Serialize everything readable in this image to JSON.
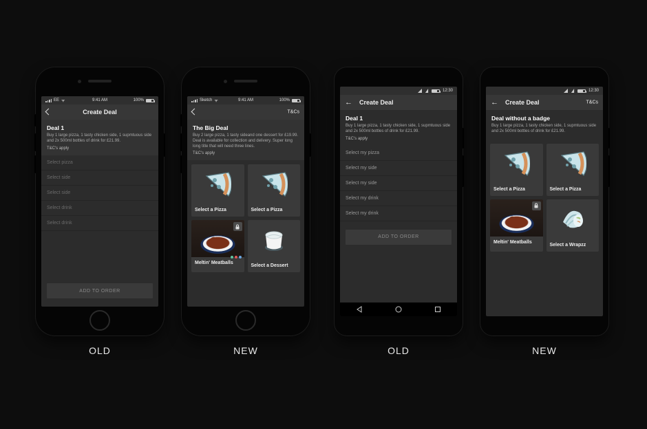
{
  "captions": {
    "p1": "OLD",
    "p2": "NEW",
    "p3": "OLD",
    "p4": "NEW"
  },
  "ios_status": {
    "carrier": "EE",
    "time": "9:41 AM",
    "battery": "100%"
  },
  "sketch_status": {
    "carrier": "Sketch",
    "time": "9:41 AM",
    "battery": "100%"
  },
  "android_status": {
    "time": "12:30"
  },
  "phone1": {
    "nav_title": "Create Deal",
    "deal_title": "Deal 1",
    "deal_desc": "Buy 1 large pizza, 1 tasty chicken side, 1 supmtuous side and 2x 500ml bottles of drink for £21.99.",
    "tcs": "T&C's apply",
    "rows": [
      "Select pizza",
      "Select side",
      "Select side",
      "Select drink",
      "Select drink"
    ],
    "cta": "ADD TO ORDER"
  },
  "phone2": {
    "nav_title": "Create Deal",
    "nav_right": "T&Cs",
    "deal_title": "The Big Deal",
    "deal_desc": "Buy 2 large pizza, 1 tasty sideand one dessert for £19.99. Deal is available for collection and delivery. Super long long title that will need three lines.",
    "tcs": "T&C's apply",
    "cards": [
      "Select a Pizza",
      "Select a Pizza",
      "Meltin' Meatballs",
      "Select a Dessert"
    ]
  },
  "phone3": {
    "nav_title": "Create Deal",
    "deal_title": "Deal 1",
    "deal_desc": "Buy 1 large pizza, 1 tasty chicken side, 1 supmtuous side and 2x 500ml bottles of drink for £21.99.",
    "tcs": "T&C's apply",
    "rows": [
      "Select my pizza",
      "Select my side",
      "Select my side",
      "Select my drink",
      "Select my drink"
    ],
    "cta": "ADD TO ORDER"
  },
  "phone4": {
    "nav_title": "Create Deal",
    "nav_right": "T&Cs",
    "deal_title": "Deal without a badge",
    "deal_desc": "Buy 1 large pizza, 1 tasty chicken side, 1 supmtuous side and 2x 500ml bottles of drink for £21.99.",
    "cards": [
      "Select a Pizza",
      "Select a Pizza",
      "Meltin' Meatballs",
      "Select a Wrapzz"
    ]
  }
}
